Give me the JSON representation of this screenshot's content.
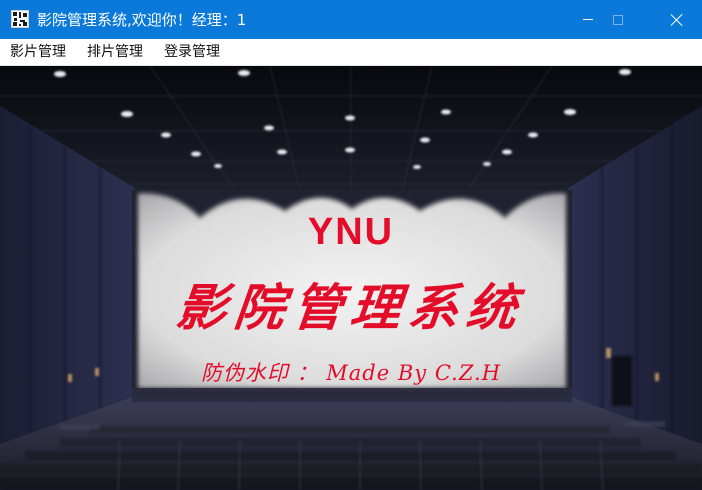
{
  "window": {
    "title": "影院管理系统,欢迎你！经理：1",
    "icon": "app-icon",
    "controls": [
      "minimize-icon",
      "maximize-icon",
      "close-icon"
    ],
    "accent_color": "#0a79d9"
  },
  "menu": {
    "items": [
      {
        "label": "影片管理"
      },
      {
        "label": "排片管理"
      },
      {
        "label": "登录管理"
      }
    ]
  },
  "background": {
    "brand": "YNU",
    "title": "影院管理系统",
    "watermark": "防伪水印 ： Made By C.Z.H",
    "text_color": "#e30d2a"
  }
}
